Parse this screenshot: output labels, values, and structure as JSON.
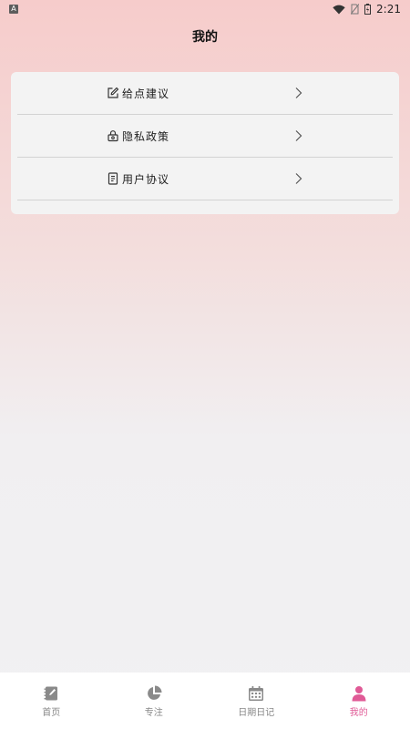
{
  "status_bar": {
    "app_badge": "A",
    "time": "2:21"
  },
  "page": {
    "title": "我的"
  },
  "menu": {
    "items": [
      {
        "label": "给点建议",
        "icon": "edit-icon"
      },
      {
        "label": "隐私政策",
        "icon": "lock-icon"
      },
      {
        "label": "用户协议",
        "icon": "document-icon"
      }
    ]
  },
  "bottom_nav": {
    "items": [
      {
        "label": "首页",
        "icon": "notebook-icon",
        "active": false
      },
      {
        "label": "专注",
        "icon": "pie-chart-icon",
        "active": false
      },
      {
        "label": "日期日记",
        "icon": "calendar-icon",
        "active": false
      },
      {
        "label": "我的",
        "icon": "user-icon",
        "active": true
      }
    ]
  },
  "colors": {
    "accent": "#e05a96",
    "inactive": "#888888",
    "gradient_top": "#f6cccb",
    "gradient_bottom": "#f1f1f3"
  }
}
